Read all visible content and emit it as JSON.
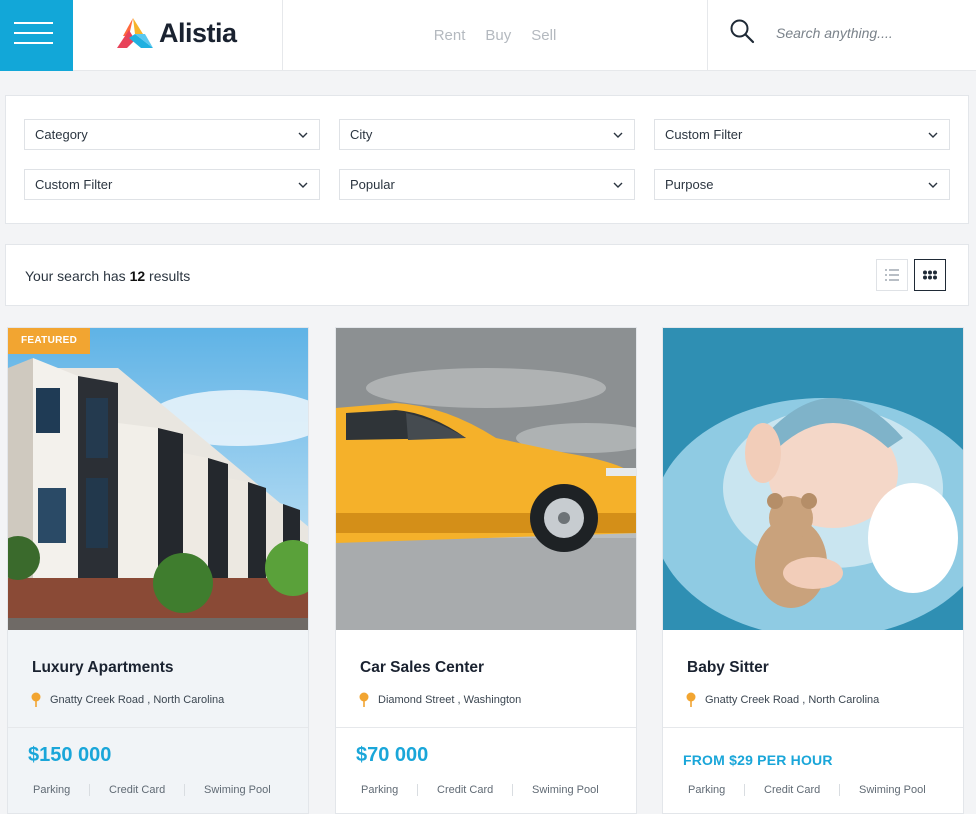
{
  "header": {
    "brand": "Alistia",
    "nav": [
      "Rent",
      "Buy",
      "Sell"
    ],
    "search_placeholder": "Search anything...."
  },
  "filters": [
    {
      "label": "Category"
    },
    {
      "label": "City"
    },
    {
      "label": "Custom Filter"
    },
    {
      "label": "Custom Filter"
    },
    {
      "label": "Popular"
    },
    {
      "label": "Purpose"
    }
  ],
  "results": {
    "prefix": "Your search has",
    "count": "12",
    "suffix": "results"
  },
  "cards": [
    {
      "badge": "FEATURED",
      "title": "Luxury Apartments",
      "location": "Gnatty Creek Road , North Carolina",
      "price": "$150 000",
      "amenities": [
        "Parking",
        "Credit Card",
        "Swiming Pool"
      ]
    },
    {
      "title": "Car Sales Center",
      "location": "Diamond Street , Washington",
      "price": "$70 000",
      "amenities": [
        "Parking",
        "Credit Card",
        "Swiming Pool"
      ]
    },
    {
      "title": "Baby Sitter",
      "location": "Gnatty Creek Road , North Carolina",
      "price": "FROM $29 PER HOUR",
      "amenities": [
        "Parking",
        "Credit Card",
        "Swiming Pool"
      ]
    }
  ],
  "colors": {
    "accent": "#12a7d8",
    "price": "#1aa6d9",
    "badge": "#f2a531"
  }
}
